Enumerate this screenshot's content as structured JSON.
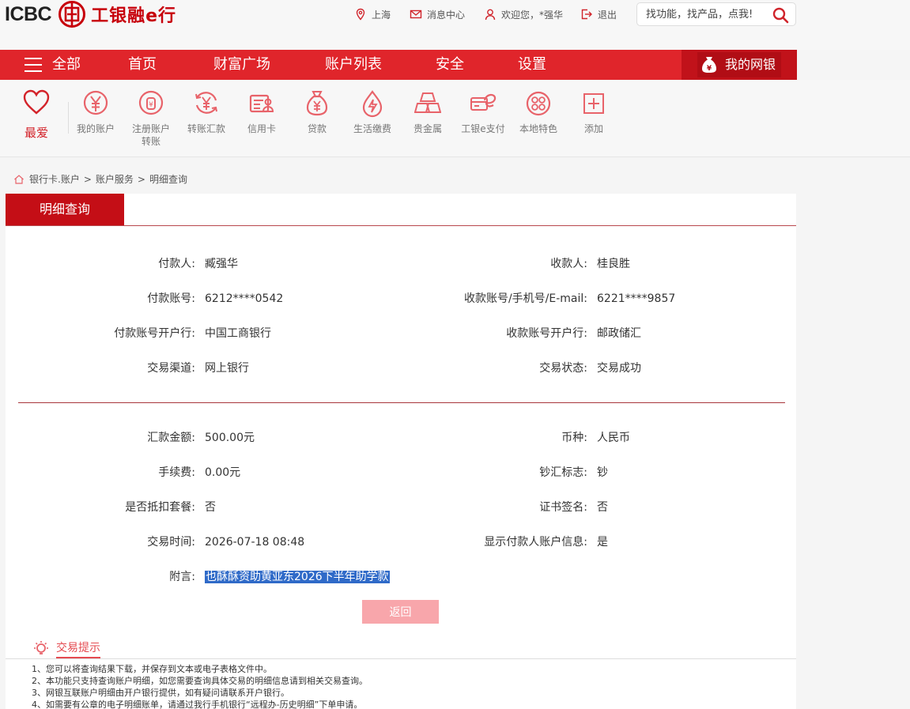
{
  "header": {
    "logo_text": "ICBC",
    "logo_cn": "工银融e行",
    "location": "上海",
    "messages": "消息中心",
    "welcome": "欢迎您，*强华",
    "logout": "退出",
    "search_placeholder": "找功能，找产品，点我!"
  },
  "nav": {
    "all": "全部",
    "items": [
      "首页",
      "财富广场",
      "账户列表",
      "安全",
      "设置"
    ],
    "mybank": "我的网银"
  },
  "shortcuts": {
    "favorite": "最爱",
    "items": [
      {
        "label": "我的账户",
        "icon": "yuan-account-icon"
      },
      {
        "label": "注册账户转账",
        "icon": "registered-transfer-icon"
      },
      {
        "label": "转账汇款",
        "icon": "transfer-icon"
      },
      {
        "label": "信用卡",
        "icon": "credit-card-icon"
      },
      {
        "label": "贷款",
        "icon": "loan-bag-icon"
      },
      {
        "label": "生活缴费",
        "icon": "utility-drop-icon"
      },
      {
        "label": "贵金属",
        "icon": "gold-bars-icon"
      },
      {
        "label": "工银e支付",
        "icon": "epay-icon"
      },
      {
        "label": "本地特色",
        "icon": "local-feature-icon"
      },
      {
        "label": "添加",
        "icon": "add-icon"
      }
    ]
  },
  "breadcrumb": [
    "银行卡.账户",
    "账户服务",
    "明细查询"
  ],
  "detail": {
    "tab": "明细查询",
    "payer_label": "付款人:",
    "payer": "臧强华",
    "payee_label": "收款人:",
    "payee": "桂良胜",
    "payer_account_label": "付款账号:",
    "payer_account": "6212****0542",
    "payee_account_label": "收款账号/手机号/E-mail:",
    "payee_account": "6221****9857",
    "payer_bank_label": "付款账号开户行:",
    "payer_bank": "中国工商银行",
    "payee_bank_label": "收款账号开户行:",
    "payee_bank": "邮政储汇",
    "channel_label": "交易渠道:",
    "channel": "网上银行",
    "status_label": "交易状态:",
    "status": "交易成功",
    "amount_label": "汇款金额:",
    "amount": "500.00元",
    "currency_label": "币种:",
    "currency": "人民币",
    "fee_label": "手续费:",
    "fee": "0.00元",
    "cash_label": "钞汇标志:",
    "cash": "钞",
    "package_label": "是否抵扣套餐:",
    "package": "否",
    "cert_label": "证书签名:",
    "cert": "否",
    "time_label": "交易时间:",
    "time": "2026-07-18 08:48",
    "show_info_label": "显示付款人账户信息:",
    "show_info": "是",
    "remark_label": "附言:",
    "remark": "也酥酥资助黄亚东2026下半年助学款",
    "back": "返回"
  },
  "tips": {
    "title": "交易提示",
    "lines": [
      "1、您可以将查询结果下载，并保存到文本或电子表格文件中。",
      "2、本功能只支持查询账户明细，如您需要查询具体交易的明细信息请到相关交易查询。",
      "3、网银互联账户明细由开户银行提供，如有疑问请联系开户银行。",
      "4、如需要有公章的电子明细账单，请通过我行手机银行“远程办-历史明细”下单申请。"
    ]
  },
  "colors": {
    "brand_red": "#e0252b",
    "dark_red": "#c40e16",
    "button_pink": "#f8a6ab",
    "highlight_blue": "#2f6ac8"
  }
}
